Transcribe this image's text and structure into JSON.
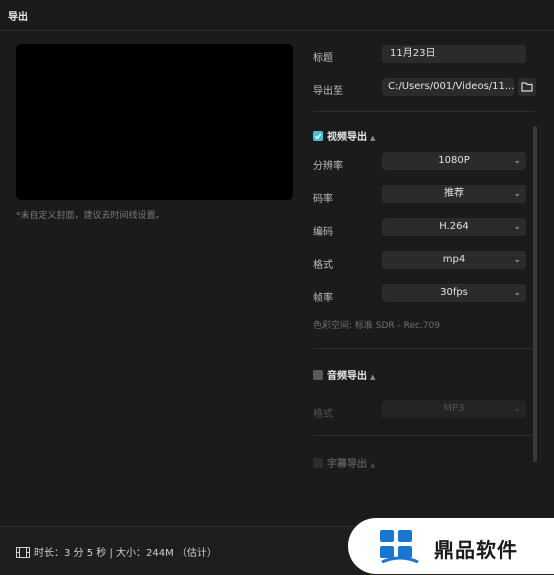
{
  "window": {
    "title": "导出"
  },
  "preview": {
    "cover_hint": "*未自定义封面，建议去时间线设置。"
  },
  "form": {
    "title_label": "标题",
    "title_value": "11月23日",
    "export_to_label": "导出至",
    "export_path": "C:/Users/001/Videos/11...",
    "folder_icon": "folder-icon"
  },
  "video_export": {
    "label": "视频导出",
    "checked": true,
    "resolution_label": "分辨率",
    "resolution_value": "1080P",
    "bitrate_label": "码率",
    "bitrate_value": "推荐",
    "codec_label": "编码",
    "codec_value": "H.264",
    "format_label": "格式",
    "format_value": "mp4",
    "framerate_label": "帧率",
    "framerate_value": "30fps",
    "color_space": "色彩空间:  标准 SDR - Rec.709"
  },
  "audio_export": {
    "label": "音频导出",
    "checked": false,
    "format_label": "格式",
    "format_value": "MP3"
  },
  "subtitle_export": {
    "label": "字幕导出",
    "checked": false
  },
  "footer": {
    "info": "时长：3 分 5 秒 | 大小：244M （估计）"
  },
  "watermark": {
    "text": "鼎品软件"
  },
  "colors": {
    "accent": "#3ec3d3",
    "background": "#1b1b1c",
    "field": "#2b2b2d"
  }
}
